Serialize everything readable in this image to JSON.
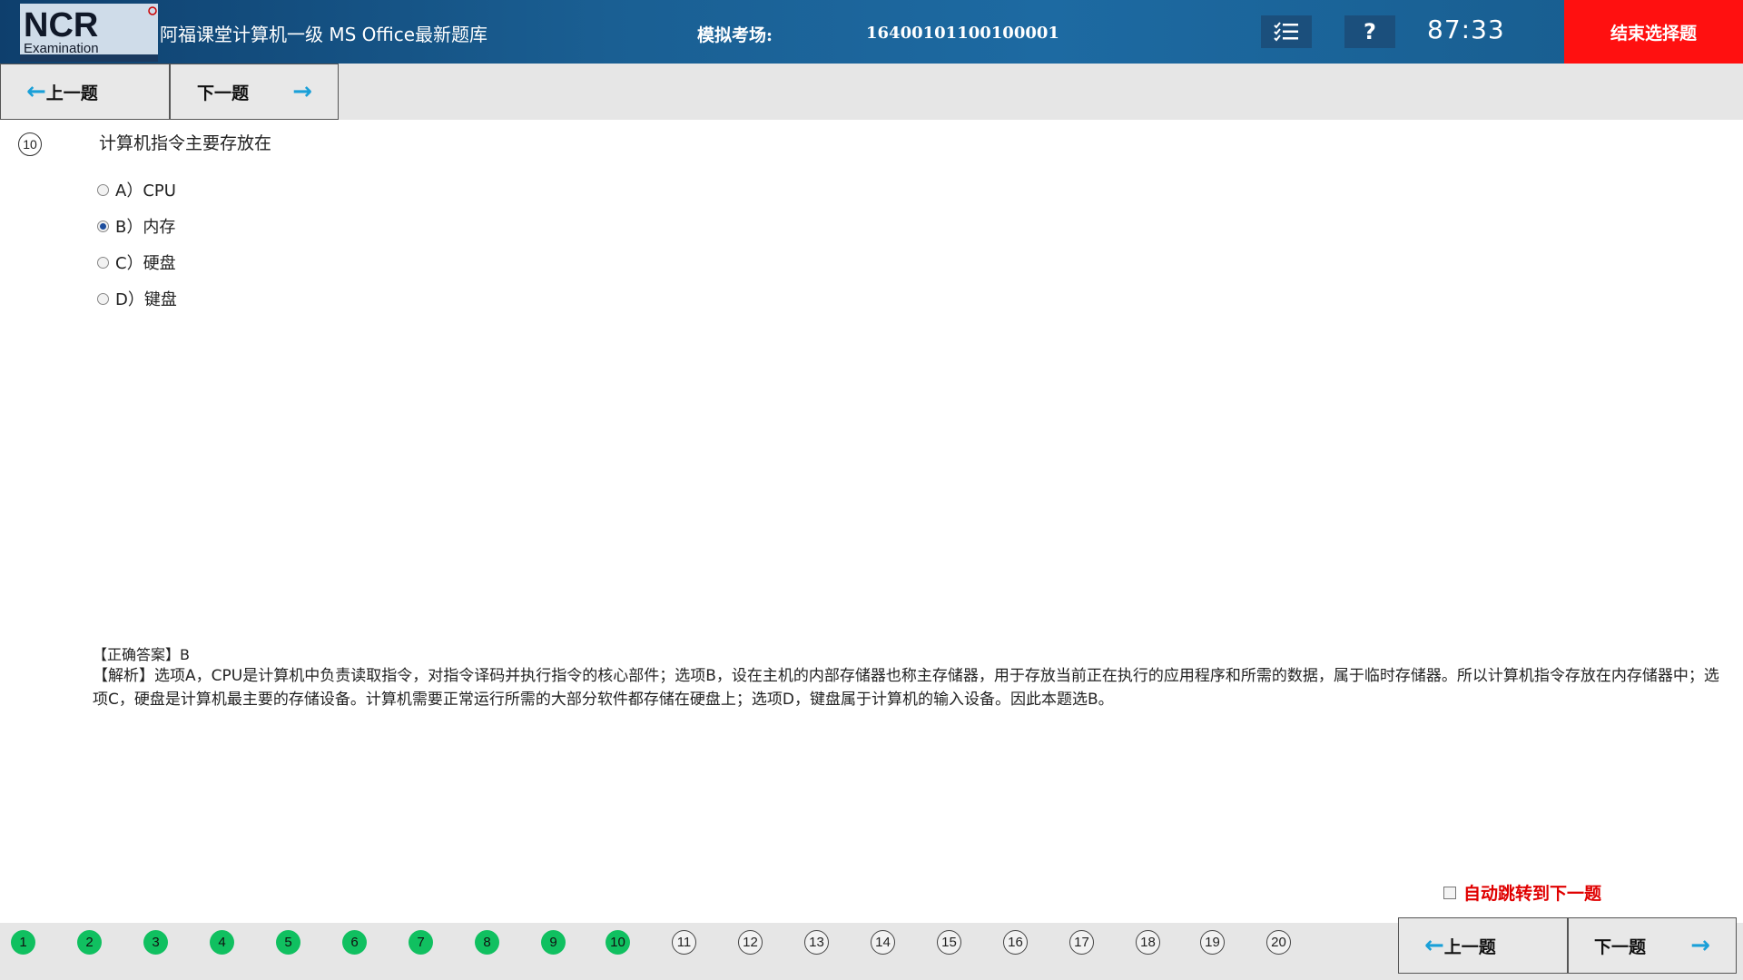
{
  "header": {
    "logo_text": "NCR",
    "logo_sub": "Examination",
    "app_title": "阿福课堂计算机一级 MS Office最新题库",
    "exam_label": "模拟考场:",
    "exam_number": "16400101100100001",
    "list_icon": "list-check-icon",
    "help_label": "?",
    "timer": "87:33",
    "end_button": "结束选择题"
  },
  "nav": {
    "prev": "上一题",
    "next": "下一题",
    "prev_arrow": "←",
    "next_arrow": "→"
  },
  "question": {
    "number": "10",
    "text": "计算机指令主要存放在",
    "options": [
      {
        "label": "A）CPU",
        "selected": false
      },
      {
        "label": "B）内存",
        "selected": true
      },
      {
        "label": "C）硬盘",
        "selected": false
      },
      {
        "label": "D）键盘",
        "selected": false
      }
    ]
  },
  "answer": {
    "correct": "【正确答案】B",
    "analysis": "【解析】选项A，CPU是计算机中负责读取指令，对指令译码并执行指令的核心部件；选项B，设在主机的内部存储器也称主存储器，用于存放当前正在执行的应用程序和所需的数据，属于临时存储器。所以计算机指令存放在内存储器中；选项C，硬盘是计算机最主要的存储设备。计算机需要正常运行所需的大部分软件都存储在硬盘上；选项D，键盘属于计算机的输入设备。因此本题选B。"
  },
  "auto_jump": {
    "label": "自动跳转到下一题",
    "checked": false
  },
  "question_nav": [
    {
      "n": "1",
      "answered": true
    },
    {
      "n": "2",
      "answered": true
    },
    {
      "n": "3",
      "answered": true
    },
    {
      "n": "4",
      "answered": true
    },
    {
      "n": "5",
      "answered": true
    },
    {
      "n": "6",
      "answered": true
    },
    {
      "n": "7",
      "answered": true
    },
    {
      "n": "8",
      "answered": true
    },
    {
      "n": "9",
      "answered": true
    },
    {
      "n": "10",
      "answered": true
    },
    {
      "n": "11",
      "answered": false
    },
    {
      "n": "12",
      "answered": false
    },
    {
      "n": "13",
      "answered": false
    },
    {
      "n": "14",
      "answered": false
    },
    {
      "n": "15",
      "answered": false
    },
    {
      "n": "16",
      "answered": false
    },
    {
      "n": "17",
      "answered": false
    },
    {
      "n": "18",
      "answered": false
    },
    {
      "n": "19",
      "answered": false
    },
    {
      "n": "20",
      "answered": false
    }
  ],
  "colors": {
    "header_blue": "#1d6aa2",
    "end_red": "#ff1010",
    "answered_green": "#10c060",
    "arrow_blue": "#1aa0d8",
    "auto_red": "#e00000"
  }
}
